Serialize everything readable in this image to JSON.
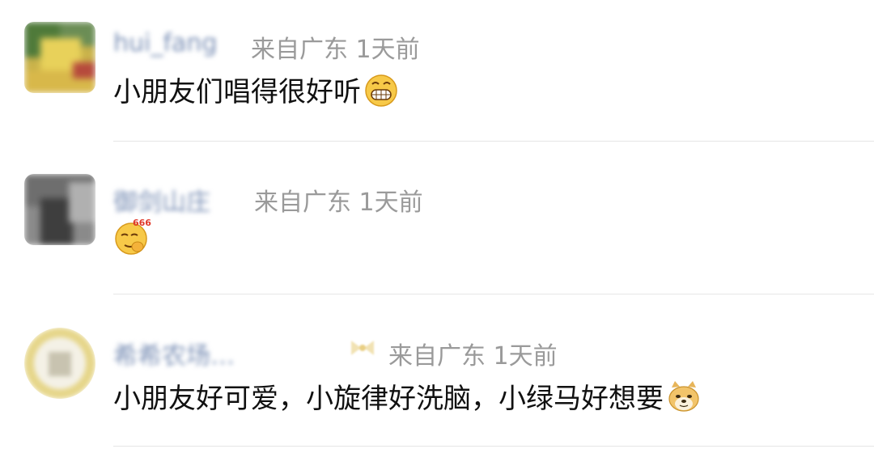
{
  "comments": [
    {
      "username": "hui_fang",
      "meta": "来自广东 1天前",
      "text": "小朋友们唱得很好听",
      "emoji": "grin-emoji"
    },
    {
      "username": "御剑山庄",
      "meta": "来自广东 1天前",
      "text": "",
      "emoji": "666-emoji"
    },
    {
      "username": "希希农场…",
      "meta": "来自广东 1天前",
      "text": "小朋友好可爱，小旋律好洗脑，小绿马好想要",
      "emoji": "doge-emoji"
    }
  ]
}
